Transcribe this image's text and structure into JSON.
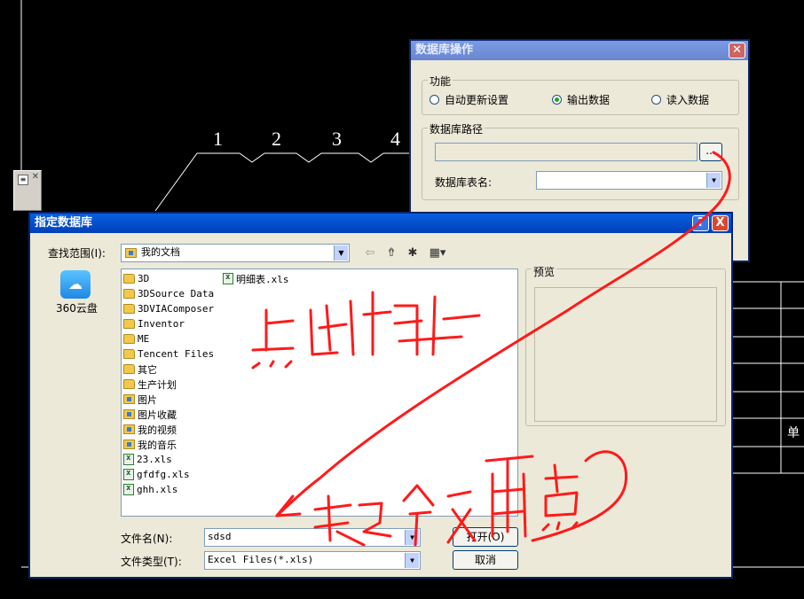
{
  "cad": {
    "numbers": [
      "1",
      "2",
      "3",
      "4"
    ],
    "table_text": "单"
  },
  "db_window": {
    "title": "数据库操作",
    "function_group": "功能",
    "radios": [
      {
        "label": "自动更新设置",
        "selected": false
      },
      {
        "label": "输出数据",
        "selected": true
      },
      {
        "label": "读入数据",
        "selected": false
      }
    ],
    "path_group": "数据库路径",
    "browse_label": "...",
    "table_name_label": "数据库表名:"
  },
  "open_dialog": {
    "title": "指定数据库",
    "help_label": "?",
    "close_label": "X",
    "lookin_label": "查找范围(I):",
    "lookin_value": "我的文档",
    "sidebar": [
      {
        "label": "360云盘"
      }
    ],
    "files": [
      {
        "name": "3D",
        "type": "folder"
      },
      {
        "name": "3DSource Data",
        "type": "folder"
      },
      {
        "name": "3DVIAComposer",
        "type": "folder"
      },
      {
        "name": "Inventor",
        "type": "folder"
      },
      {
        "name": "ME",
        "type": "folder"
      },
      {
        "name": "Tencent Files",
        "type": "folder"
      },
      {
        "name": "其它",
        "type": "folder"
      },
      {
        "name": "生产计划",
        "type": "folder"
      },
      {
        "name": "图片",
        "type": "special"
      },
      {
        "name": "图片收藏",
        "type": "special"
      },
      {
        "name": "我的视频",
        "type": "special"
      },
      {
        "name": "我的音乐",
        "type": "special"
      },
      {
        "name": "23.xls",
        "type": "xls"
      },
      {
        "name": "gfdfg.xls",
        "type": "xls"
      },
      {
        "name": "ghh.xls",
        "type": "xls"
      },
      {
        "name": "明细表.xls",
        "type": "xls"
      }
    ],
    "preview_label": "预览",
    "filename_label": "文件名(N):",
    "filename_value": "sdsd",
    "filetype_label": "文件类型(T):",
    "filetype_value": "Excel Files(*.xls)",
    "open_button": "打开(O)",
    "cancel_button": "取消"
  },
  "colors": {
    "annotation": "#ff1a1a",
    "titlebar": "#0a5fe0"
  }
}
